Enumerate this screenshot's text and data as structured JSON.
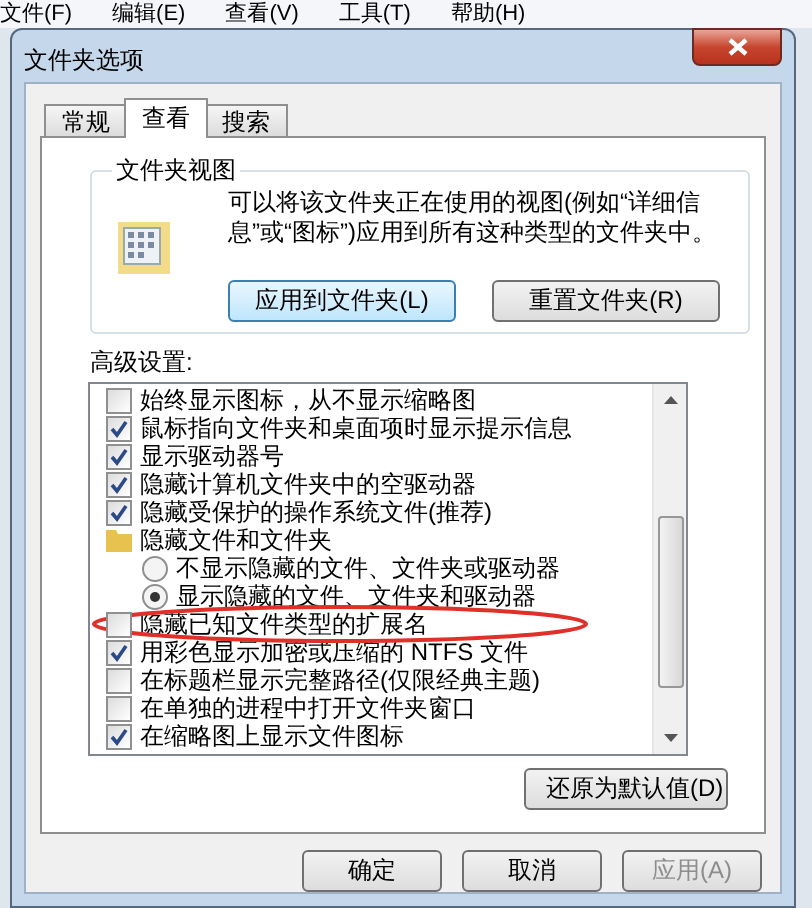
{
  "menu_bar": [
    "文件(F)",
    "编辑(E)",
    "查看(V)",
    "工具(T)",
    "帮助(H)"
  ],
  "window": {
    "title": "文件夹选项"
  },
  "tabs": [
    {
      "label": "常规",
      "selected": false
    },
    {
      "label": "查看",
      "selected": true
    },
    {
      "label": "搜索",
      "selected": false
    }
  ],
  "folder_views": {
    "title": "文件夹视图",
    "description": "可以将该文件夹正在使用的视图(例如“详细信息”或“图标”)应用到所有这种类型的文件夹中。",
    "buttons": [
      "应用到文件夹(L)",
      "重置文件夹(R)"
    ]
  },
  "advanced": {
    "label": "高级设置:",
    "items": [
      {
        "kind": "checkbox",
        "label": "始终显示图标，从不显示缩略图",
        "checked": false
      },
      {
        "kind": "checkbox",
        "label": "鼠标指向文件夹和桌面项时显示提示信息",
        "checked": true
      },
      {
        "kind": "checkbox",
        "label": "显示驱动器号",
        "checked": true
      },
      {
        "kind": "checkbox",
        "label": "隐藏计算机文件夹中的空驱动器",
        "checked": true
      },
      {
        "kind": "checkbox",
        "label": "隐藏受保护的操作系统文件(推荐)",
        "checked": true
      },
      {
        "kind": "group",
        "label": "隐藏文件和文件夹"
      },
      {
        "kind": "radio",
        "label": "不显示隐藏的文件、文件夹或驱动器",
        "selected": false
      },
      {
        "kind": "radio",
        "label": "显示隐藏的文件、文件夹和驱动器",
        "selected": true
      },
      {
        "kind": "checkbox",
        "label": "隐藏已知文件类型的扩展名",
        "checked": false,
        "circled": true
      },
      {
        "kind": "checkbox",
        "label": "用彩色显示加密或压缩的 NTFS 文件",
        "checked": true
      },
      {
        "kind": "checkbox",
        "label": "在标题栏显示完整路径(仅限经典主题)",
        "checked": false
      },
      {
        "kind": "checkbox",
        "label": "在单独的进程中打开文件夹窗口",
        "checked": false
      },
      {
        "kind": "checkbox",
        "label": "在缩略图上显示文件图标",
        "checked": true
      }
    ],
    "restore_button": "还原为默认值(D)"
  },
  "buttons": [
    {
      "label": "确定",
      "disabled": false
    },
    {
      "label": "取消",
      "disabled": false
    },
    {
      "label": "应用(A)",
      "disabled": true
    }
  ]
}
